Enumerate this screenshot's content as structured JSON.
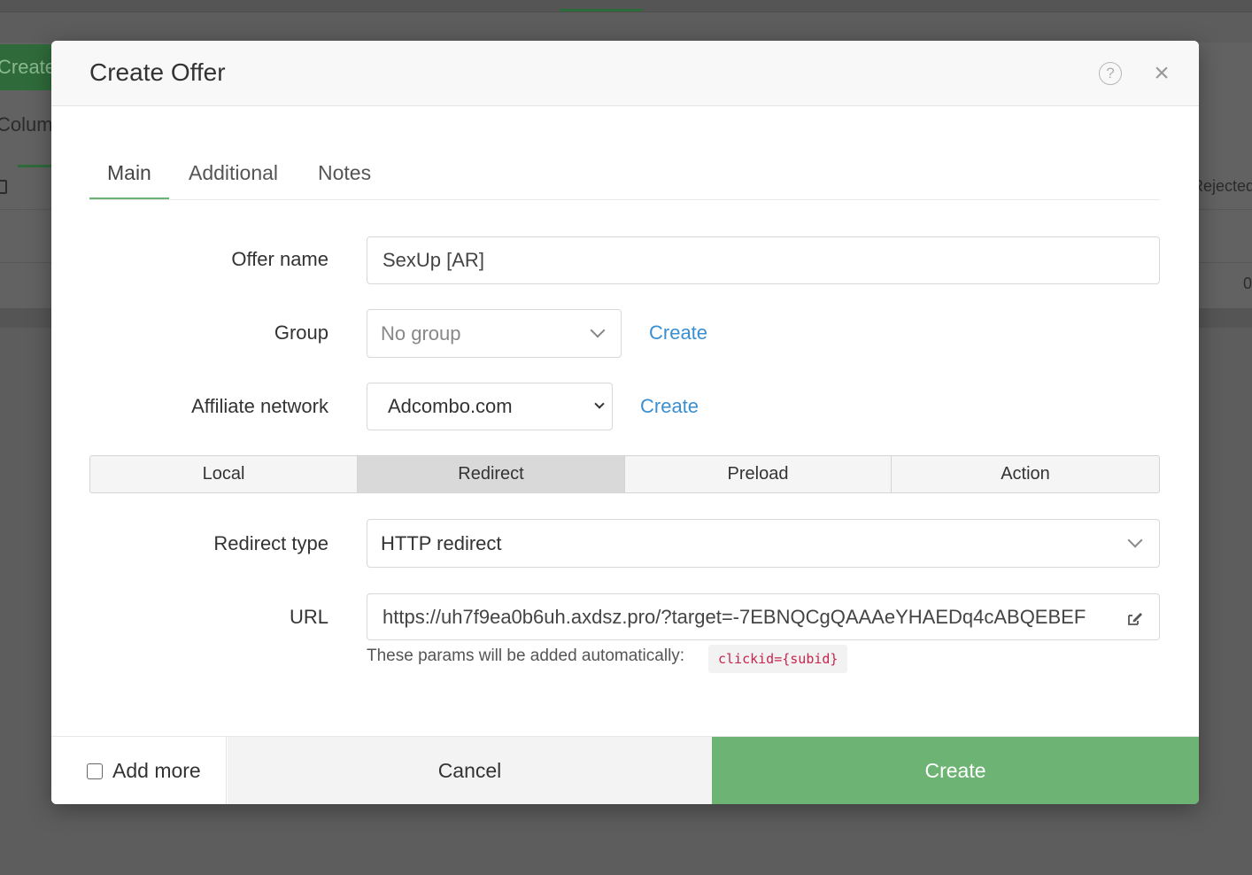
{
  "background": {
    "create_button": "Create",
    "columns_label": "Columns",
    "rejected_label": "Rejected",
    "zero_value": "0"
  },
  "modal": {
    "title": "Create Offer",
    "tabs": [
      {
        "label": "Main",
        "active": true
      },
      {
        "label": "Additional",
        "active": false
      },
      {
        "label": "Notes",
        "active": false
      }
    ],
    "offer_name": {
      "label": "Offer name",
      "value": "SexUp [AR]"
    },
    "group": {
      "label": "Group",
      "value": "No group",
      "create_link": "Create"
    },
    "affiliate_network": {
      "label": "Affiliate network",
      "value": "Adcombo.com",
      "create_link": "Create"
    },
    "modes": [
      {
        "label": "Local",
        "active": false
      },
      {
        "label": "Redirect",
        "active": true
      },
      {
        "label": "Preload",
        "active": false
      },
      {
        "label": "Action",
        "active": false
      }
    ],
    "redirect_type": {
      "label": "Redirect type",
      "value": "HTTP redirect"
    },
    "url": {
      "label": "URL",
      "value": "https://uh7f9ea0b6uh.axdsz.pro/?target=-7EBNQCgQAAAeYHAEDq4cABQEBEF",
      "hint": "These params will be added automatically:",
      "params": "clickid={subid}"
    },
    "footer": {
      "add_more": "Add more",
      "cancel": "Cancel",
      "create": "Create"
    }
  },
  "colors": {
    "accent_green": "#6db373",
    "link_blue": "#3a8fd0",
    "code_red": "#c7254e"
  },
  "icons": {
    "help": "help-circle-icon",
    "close": "close-icon",
    "dropdown": "chevron-down-icon",
    "edit": "edit-icon"
  }
}
